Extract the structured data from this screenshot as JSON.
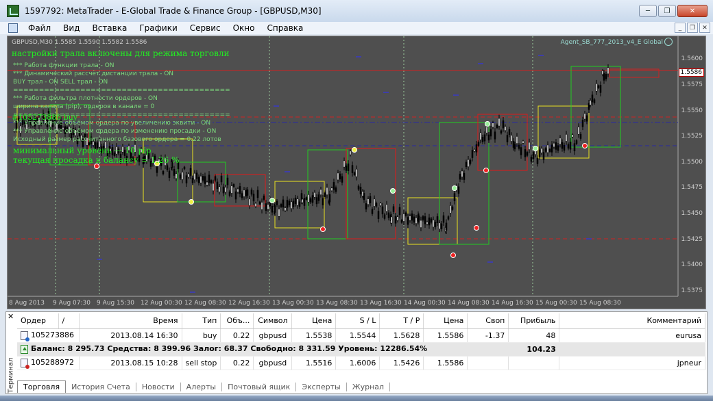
{
  "window": {
    "title": "1597792: MetaTrader - E-Global Trade & Finance Group - [GBPUSD,M30]"
  },
  "menu": [
    "Файл",
    "Вид",
    "Вставка",
    "Графики",
    "Сервис",
    "Окно",
    "Справка"
  ],
  "chart": {
    "symbol_info": "GBPUSD,M30  1.5585 1.5590 1.5582 1.5586",
    "ea_name": "Agent_SB_777_2013_v4_E Global",
    "trail_title": "настройки трала включены для режима  торговли",
    "info_lines": [
      "*** Работа функции трала -   ON",
      "*** Динамический рассчёт дистанции трала -   ON",
      "BUY трал -   ON   SELL трал -   ON",
      "==========================================",
      "*** Работа фильтра плотности ордеров -   ON",
      "ширина канала (pip), ордеров в канале =  0",
      "==========================================",
      "*** Управление объёмом ордера по увеличению эквити -   ON",
      "*** Управление объёмом ордера по изменению просадки -   ON",
      "Исходный размер рассчитанного базового ордера =   0.22 лотов"
    ],
    "overlay_green_1": "минимальный уровень — 10 pip",
    "overlay_green_2": "текущая просадка к балансу = 1.26 %",
    "overlay_green_mid": "#105273886 buy",
    "price_axis": [
      "1.5600",
      "1.5575",
      "1.5550",
      "1.5525",
      "1.5500",
      "1.5475",
      "1.5450",
      "1.5425",
      "1.5400",
      "1.5375"
    ],
    "current_price": "1.5586",
    "time_axis": [
      "8 Aug 2013",
      "9 Aug 07:30",
      "9 Aug 15:30",
      "12 Aug 00:30",
      "12 Aug 08:30",
      "12 Aug 16:30",
      "13 Aug 00:30",
      "13 Aug 08:30",
      "13 Aug 16:30",
      "14 Aug 00:30",
      "14 Aug 08:30",
      "14 Aug 16:30",
      "15 Aug 00:30",
      "15 Aug 08:30"
    ],
    "colors": {
      "background": "#4f4f4f",
      "candles": "#000000",
      "red_box": "#e01818",
      "green_box": "#22cc22",
      "yellow_box": "#e8e020",
      "blue_line": "#2a2aa0",
      "red_line": "#d02020"
    }
  },
  "terminal": {
    "side_label": "Терминал",
    "columns": [
      "Ордер",
      "/",
      "Время",
      "Тип",
      "Объ...",
      "Символ",
      "Цена",
      "S / L",
      "T / P",
      "Цена",
      "Своп",
      "Прибыль",
      "Комментарий"
    ],
    "rows": [
      {
        "order": "105273886",
        "time": "2013.08.14 16:30",
        "type": "buy",
        "volume": "0.22",
        "symbol": "gbpusd",
        "price": "1.5538",
        "sl": "1.5544",
        "tp": "1.5628",
        "cur_price": "1.5586",
        "swap": "-1.37",
        "profit": "48",
        "comment": "eurusa"
      },
      {
        "order": "105288972",
        "time": "2013.08.15 10:28",
        "type": "sell stop",
        "volume": "0.22",
        "symbol": "gbpusd",
        "price": "1.5516",
        "sl": "1.6006",
        "tp": "1.5426",
        "cur_price": "1.5586",
        "swap": "",
        "profit": "",
        "comment": "jpneur"
      }
    ],
    "balance_text": "Баланс: 8 295.73  Средства: 8 399.96  Залог: 68.37  Свободно: 8 331.59  Уровень: 12286.54%",
    "balance_profit": "104.23",
    "tabs": [
      "Торговля",
      "История Счета",
      "Новости",
      "Алерты",
      "Почтовый ящик",
      "Эксперты",
      "Журнал"
    ]
  }
}
